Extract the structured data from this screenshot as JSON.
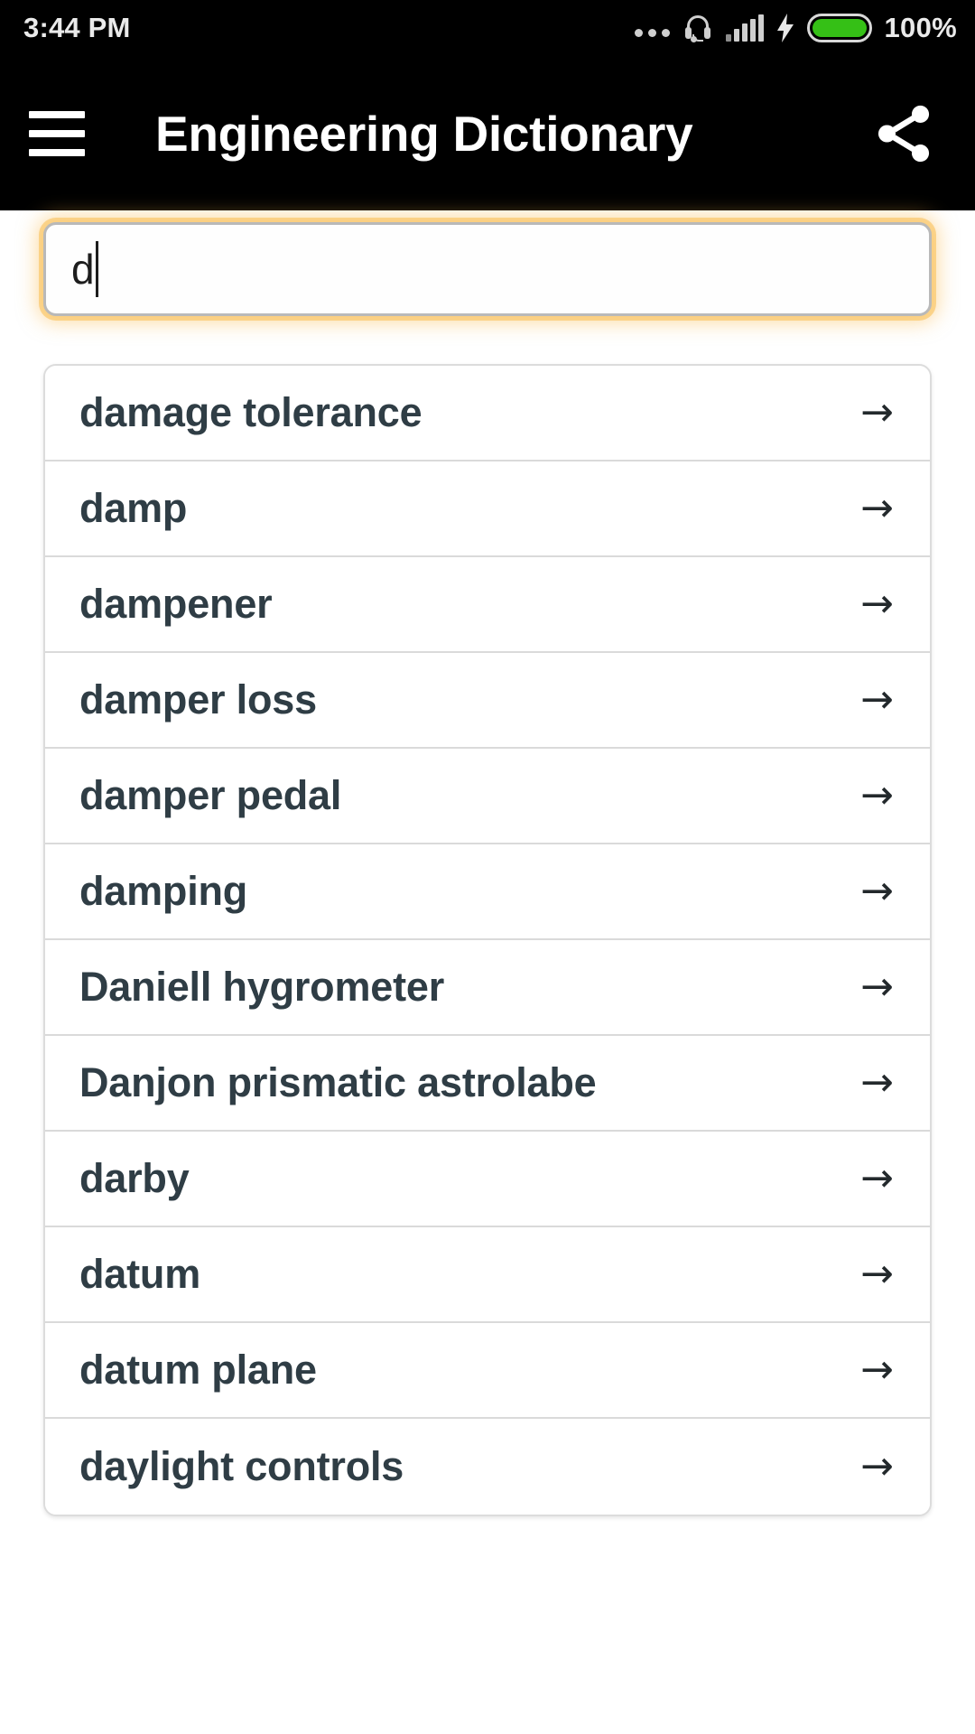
{
  "status_bar": {
    "time": "3:44 PM",
    "battery_percent": "100%",
    "icons": [
      "more-dots-icon",
      "headset-icon",
      "signal-bars-icon",
      "charging-bolt-icon",
      "battery-icon"
    ],
    "battery_color": "#35c016"
  },
  "app_bar": {
    "menu_icon": "hamburger-menu-icon",
    "title": "Engineering Dictionary",
    "share_icon": "share-icon",
    "background": "#000000"
  },
  "search": {
    "value": "d",
    "placeholder": "",
    "focus_glow_color": "#fabe50"
  },
  "results": {
    "arrow_glyph": "→",
    "items": [
      {
        "label": "damage tolerance"
      },
      {
        "label": "damp"
      },
      {
        "label": "dampener"
      },
      {
        "label": "damper loss"
      },
      {
        "label": "damper pedal"
      },
      {
        "label": "damping"
      },
      {
        "label": "Daniell hygrometer"
      },
      {
        "label": "Danjon prismatic astrolabe"
      },
      {
        "label": "darby"
      },
      {
        "label": "datum"
      },
      {
        "label": "datum plane"
      },
      {
        "label": "daylight controls"
      }
    ]
  },
  "colors": {
    "text_primary": "#2f3d45",
    "page_background": "#ffffff",
    "divider": "#dadada"
  }
}
